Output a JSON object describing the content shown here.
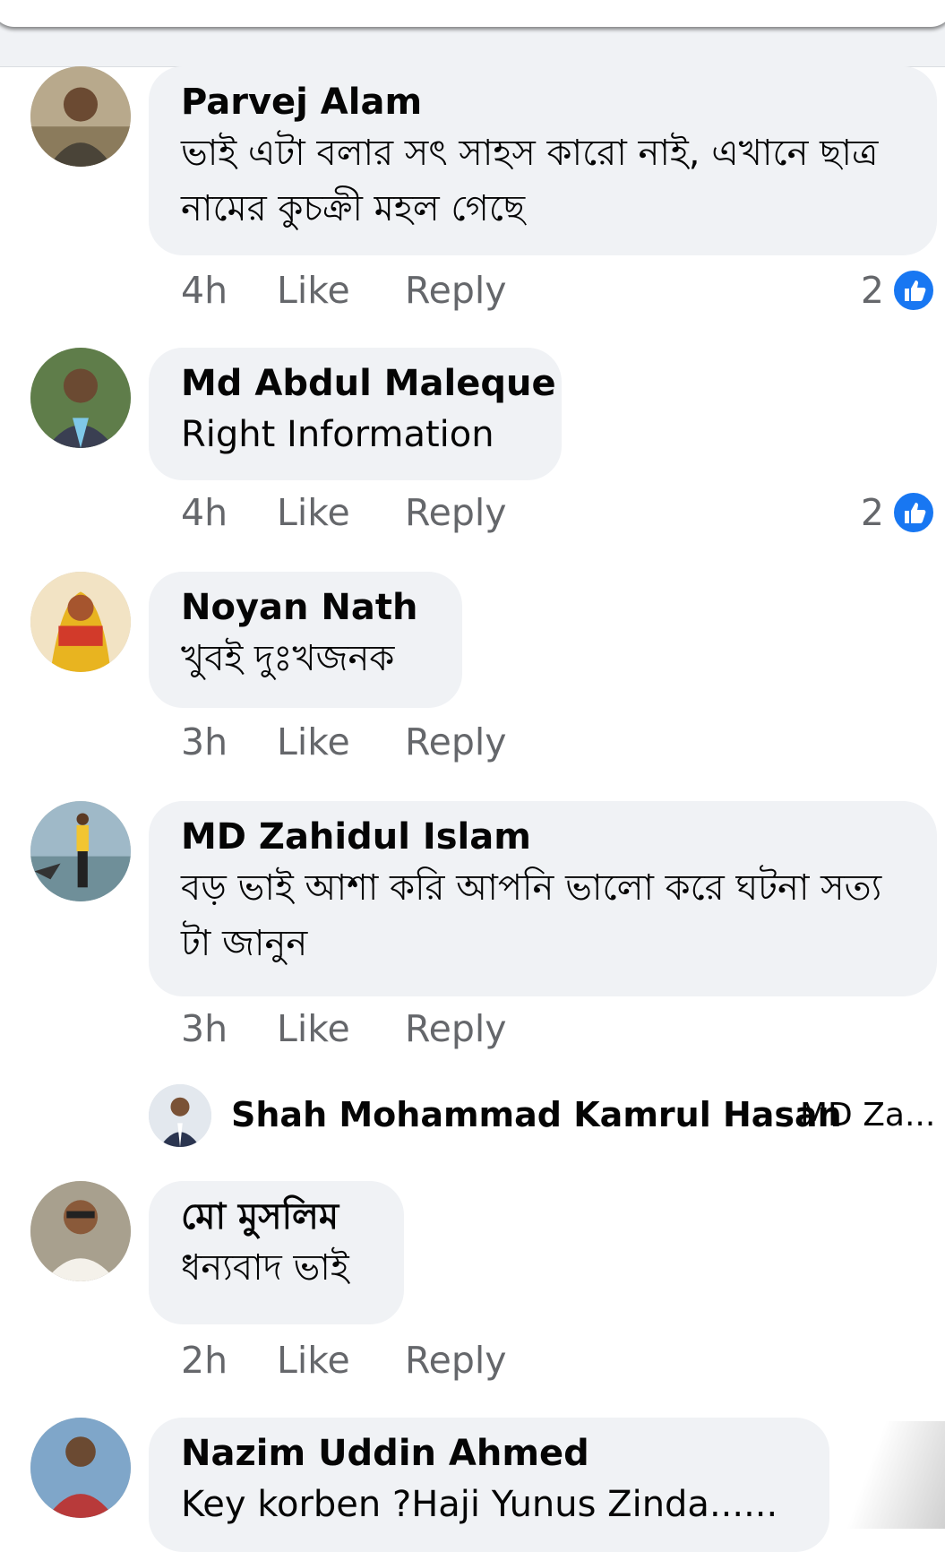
{
  "comments": [
    {
      "author": "Parvej Alam",
      "text": "ভাই এটা বলার সৎ সাহস  কারো নাই, এখানে ছাত্র নামের কুচক্রী মহল গেছে",
      "time": "4h",
      "like_label": "Like",
      "reply_label": "Reply",
      "reaction_count": "2"
    },
    {
      "author": "Md Abdul Maleque",
      "text": "Right Information",
      "time": "4h",
      "like_label": "Like",
      "reply_label": "Reply",
      "reaction_count": "2"
    },
    {
      "author": "Noyan Nath",
      "text": "খুবই দুঃখজনক",
      "time": "3h",
      "like_label": "Like",
      "reply_label": "Reply"
    },
    {
      "author": "MD Zahidul Islam",
      "text": "বড় ভাই আশা করি  আপনি ভালো করে ঘটনা সত্য টা জানুন",
      "time": "3h",
      "like_label": "Like",
      "reply_label": "Reply"
    },
    {
      "author": "মো মুসলিম",
      "text": "ধন্যবাদ ভাই",
      "time": "2h",
      "like_label": "Like",
      "reply_label": "Reply"
    },
    {
      "author": "Nazim Uddin Ahmed",
      "text": "Key korben ?Haji Yunus Zinda......"
    }
  ],
  "reply_preview": {
    "author": "Shah Mohammad Kamrul Hasan",
    "snippet": "MD Za..."
  },
  "colors": {
    "bubble": "#f0f2f5",
    "meta_text": "#65676b",
    "like_blue": "#1877f2"
  }
}
